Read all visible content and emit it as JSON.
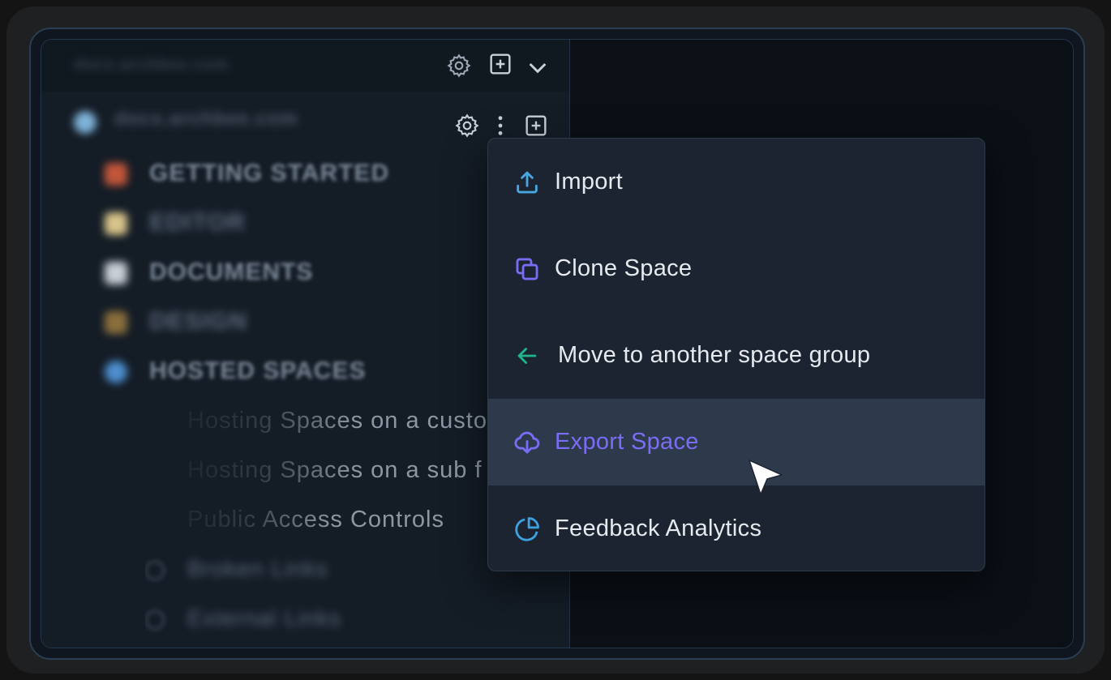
{
  "sidebar": {
    "org_name": "docs.archbee.com",
    "space_name": "docs.archbee.com",
    "items": [
      {
        "label": "GETTING STARTED",
        "icon": "rocket-icon",
        "color": "#c2563a"
      },
      {
        "label": "EDITOR",
        "icon": "note-icon",
        "color": "#d8c48a"
      },
      {
        "label": "DOCUMENTS",
        "icon": "page-icon",
        "color": "#c9ced6"
      },
      {
        "label": "DESIGN",
        "icon": "paint-icon",
        "color": "#8a6f3c"
      },
      {
        "label": "HOSTED SPACES",
        "icon": "globe-icon",
        "color": "#4d8fcf"
      }
    ],
    "sub_items": [
      {
        "label": "Hosting Spaces on a custo"
      },
      {
        "label": "Hosting Spaces on a sub f"
      },
      {
        "label": "Public Access Controls"
      },
      {
        "label": "Broken Links"
      },
      {
        "label": "External Links"
      }
    ]
  },
  "menu": {
    "items": [
      {
        "label": "Import",
        "icon": "upload-icon",
        "color": "#4aa6e0",
        "active": false
      },
      {
        "label": "Clone Space",
        "icon": "clone-icon",
        "color": "#7b6cf6",
        "active": false
      },
      {
        "label": "Move to another space group",
        "icon": "arrow-left-icon",
        "color": "#1fb58a",
        "active": false
      },
      {
        "label": "Export Space",
        "icon": "cloud-download-icon",
        "color": "#7b6cf6",
        "active": true
      },
      {
        "label": "Feedback Analytics",
        "icon": "pie-chart-icon",
        "color": "#3fa2e0",
        "active": false
      }
    ]
  }
}
